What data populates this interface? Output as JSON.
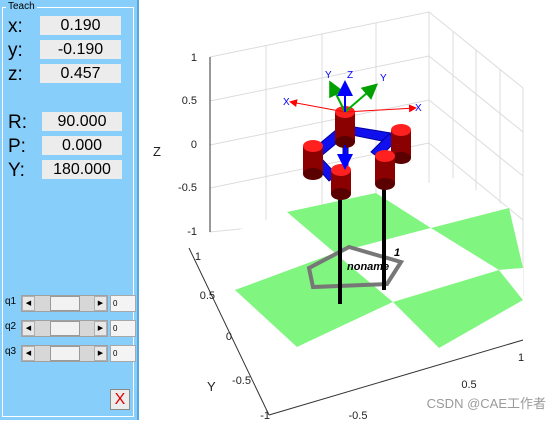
{
  "teach": {
    "title": "Teach",
    "position": [
      {
        "label": "x:",
        "value": "0.190"
      },
      {
        "label": "y:",
        "value": "-0.190"
      },
      {
        "label": "z:",
        "value": "0.457"
      }
    ],
    "orientation": [
      {
        "label": "R:",
        "value": "90.000"
      },
      {
        "label": "P:",
        "value": "0.000"
      },
      {
        "label": "Y:",
        "value": "180.000"
      }
    ],
    "joints": [
      {
        "label": "q1",
        "value": "0"
      },
      {
        "label": "q2",
        "value": "0"
      },
      {
        "label": "q3",
        "value": "0"
      }
    ],
    "close_label": "X",
    "close_icon": "close-icon"
  },
  "plot": {
    "z_label": "Z",
    "y_label": "Y",
    "z_ticks": [
      "1",
      "0.5",
      "0",
      "-0.5",
      "-1"
    ],
    "y_ticks": [
      "1",
      "0.5",
      "0",
      "-0.5",
      "-1"
    ],
    "x_ticks": [
      "1",
      "0.5",
      "-0.5"
    ],
    "robot_name": "noname",
    "robot_index": "1",
    "frame_labels": {
      "x": "X",
      "y": "Y",
      "z": "Z"
    },
    "colors": {
      "floor_green": "#80f580",
      "link_blue": "#1010ee",
      "joint_red": "#d80000",
      "axis_red": "#ff0000",
      "axis_green": "#00b000",
      "axis_blue": "#0000ff"
    }
  },
  "watermark": "CSDN @CAE工作者"
}
